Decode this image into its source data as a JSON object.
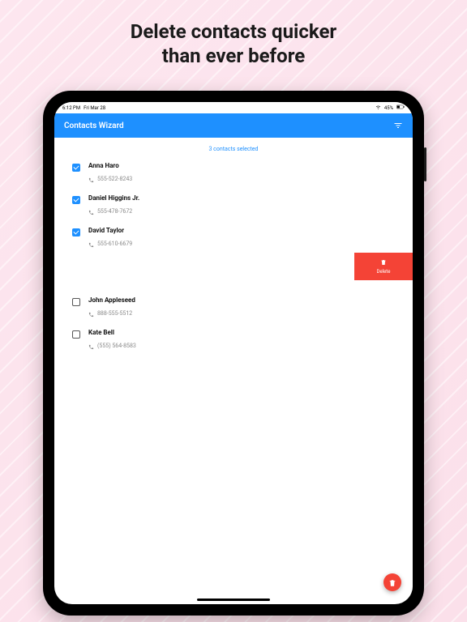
{
  "headline": {
    "line1": "Delete contacts quicker",
    "line2": "than ever before"
  },
  "status": {
    "time": "6:12 PM",
    "date": "Fri Mar 28",
    "battery": "45%"
  },
  "nav": {
    "title": "Contacts Wizard"
  },
  "selection_count": "3 contacts selected",
  "contacts_selected": [
    {
      "name": "Anna Haro",
      "phone": "555-522-8243",
      "checked": true
    },
    {
      "name": "Daniel Higgins Jr.",
      "phone": "555-478-7672",
      "checked": true
    },
    {
      "name": "David Taylor",
      "phone": "555-610-6679",
      "checked": true
    }
  ],
  "contacts_unselected": [
    {
      "name": "John Appleseed",
      "phone": "888-555-5512",
      "checked": false
    },
    {
      "name": "Kate Bell",
      "phone": "(555) 564-8583",
      "checked": false
    }
  ],
  "delete_action": {
    "label": "Delete"
  }
}
